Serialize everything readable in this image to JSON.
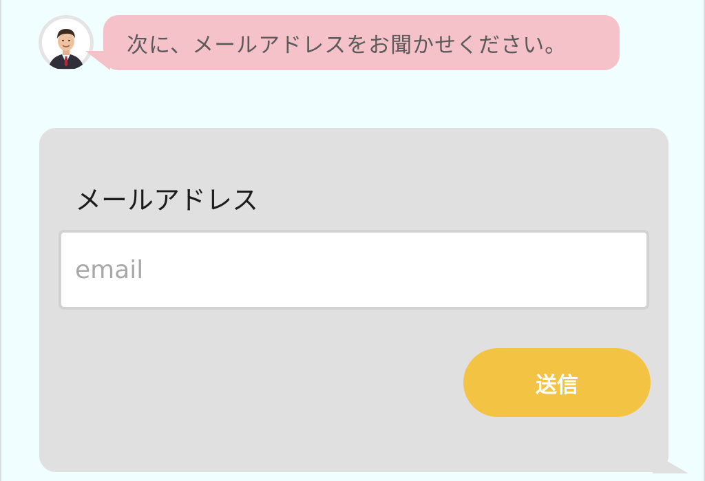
{
  "chat": {
    "bot_message": "次に、メールアドレスをお聞かせください。"
  },
  "form": {
    "label": "メールアドレス",
    "email_placeholder": "email",
    "email_value": "",
    "submit_label": "送信"
  },
  "colors": {
    "page_background": "#f0feff",
    "bot_bubble": "#f6c2ca",
    "form_card": "#e0e0e0",
    "submit_button": "#f3c443"
  }
}
